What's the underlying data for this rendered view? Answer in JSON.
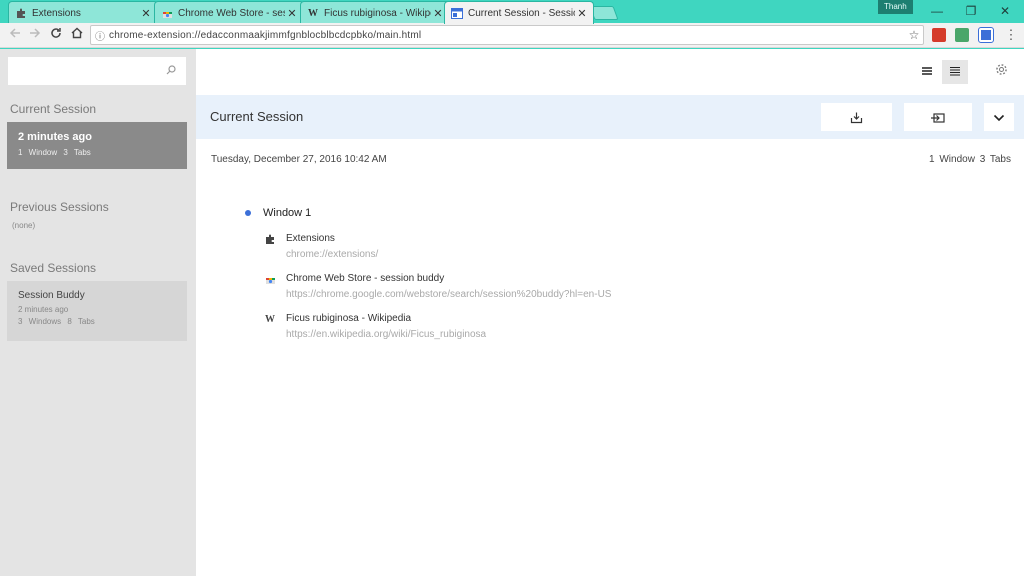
{
  "browser": {
    "tabs": [
      {
        "title": "Extensions",
        "icon": "puzzle-icon"
      },
      {
        "title": "Chrome Web Store - ses",
        "icon": "webstore-icon"
      },
      {
        "title": "Ficus rubiginosa - Wikipe",
        "icon": "wikipedia-icon"
      },
      {
        "title": "Current Session - Session",
        "icon": "session-buddy-icon"
      }
    ],
    "tab_close_glyph": "✕",
    "profile_name": "Thanh",
    "window_controls": {
      "minimize": "—",
      "restore": "❐",
      "close": "✕"
    },
    "url": "chrome-extension://edacconmaakjimmfgnblocblbcdcpbko/main.html"
  },
  "sidebar": {
    "search_placeholder": "",
    "current_session": {
      "heading": "Current Session",
      "card_title": "2 minutes ago",
      "card_windows": "1 Window",
      "card_tabs": "3 Tabs"
    },
    "previous_sessions": {
      "heading": "Previous Sessions",
      "empty_text": "(none)"
    },
    "saved_sessions": {
      "heading": "Saved Sessions",
      "card_title": "Session Buddy",
      "card_time": "2 minutes ago",
      "card_windows": "3 Windows",
      "card_tabs": "8 Tabs"
    }
  },
  "main": {
    "title": "Current Session",
    "date": "Tuesday, December 27, 2016 10:42 AM",
    "count_windows": "1 Window",
    "count_tabs": "3 Tabs",
    "window_label": "Window 1",
    "tabs": [
      {
        "title": "Extensions",
        "url": "chrome://extensions/",
        "icon": "puzzle-icon"
      },
      {
        "title": "Chrome Web Store - session buddy",
        "url": "https://chrome.google.com/webstore/search/session%20buddy?hl=en-US",
        "icon": "webstore-icon"
      },
      {
        "title": "Ficus rubiginosa - Wikipedia",
        "url": "https://en.wikipedia.org/wiki/Ficus_rubiginosa",
        "icon": "wikipedia-icon"
      }
    ]
  },
  "colors": {
    "tabstrip": "#3fd6c0",
    "band": "#e8f1fb",
    "window_dot": "#3b6fd8",
    "current_card": "#8a8a8a"
  }
}
